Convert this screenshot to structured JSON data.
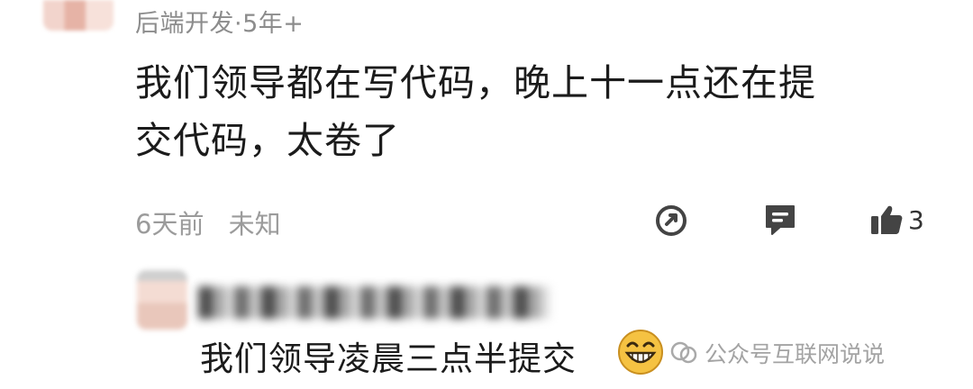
{
  "comment": {
    "author_line": "后端开发·5年+",
    "text_line1": "我们领导都在写代码，晚上十一点还在提",
    "text_line2": "交代码，太卷了",
    "time": "6天前",
    "location": "未知",
    "like_count": "3",
    "icons": {
      "share": "share-icon",
      "reply": "comment-icon",
      "like": "thumbs-up-icon"
    }
  },
  "reply": {
    "text": "我们领导凌晨三点半提交",
    "emoji": "grinning-face-emoji"
  },
  "watermark": {
    "text": "公众号互联网说说",
    "icon": "wechat-official-account-icon"
  },
  "colors": {
    "text": "#1b1b1b",
    "muted": "#8c8c8c",
    "icon": "#444444",
    "emoji": "#f5c242"
  }
}
